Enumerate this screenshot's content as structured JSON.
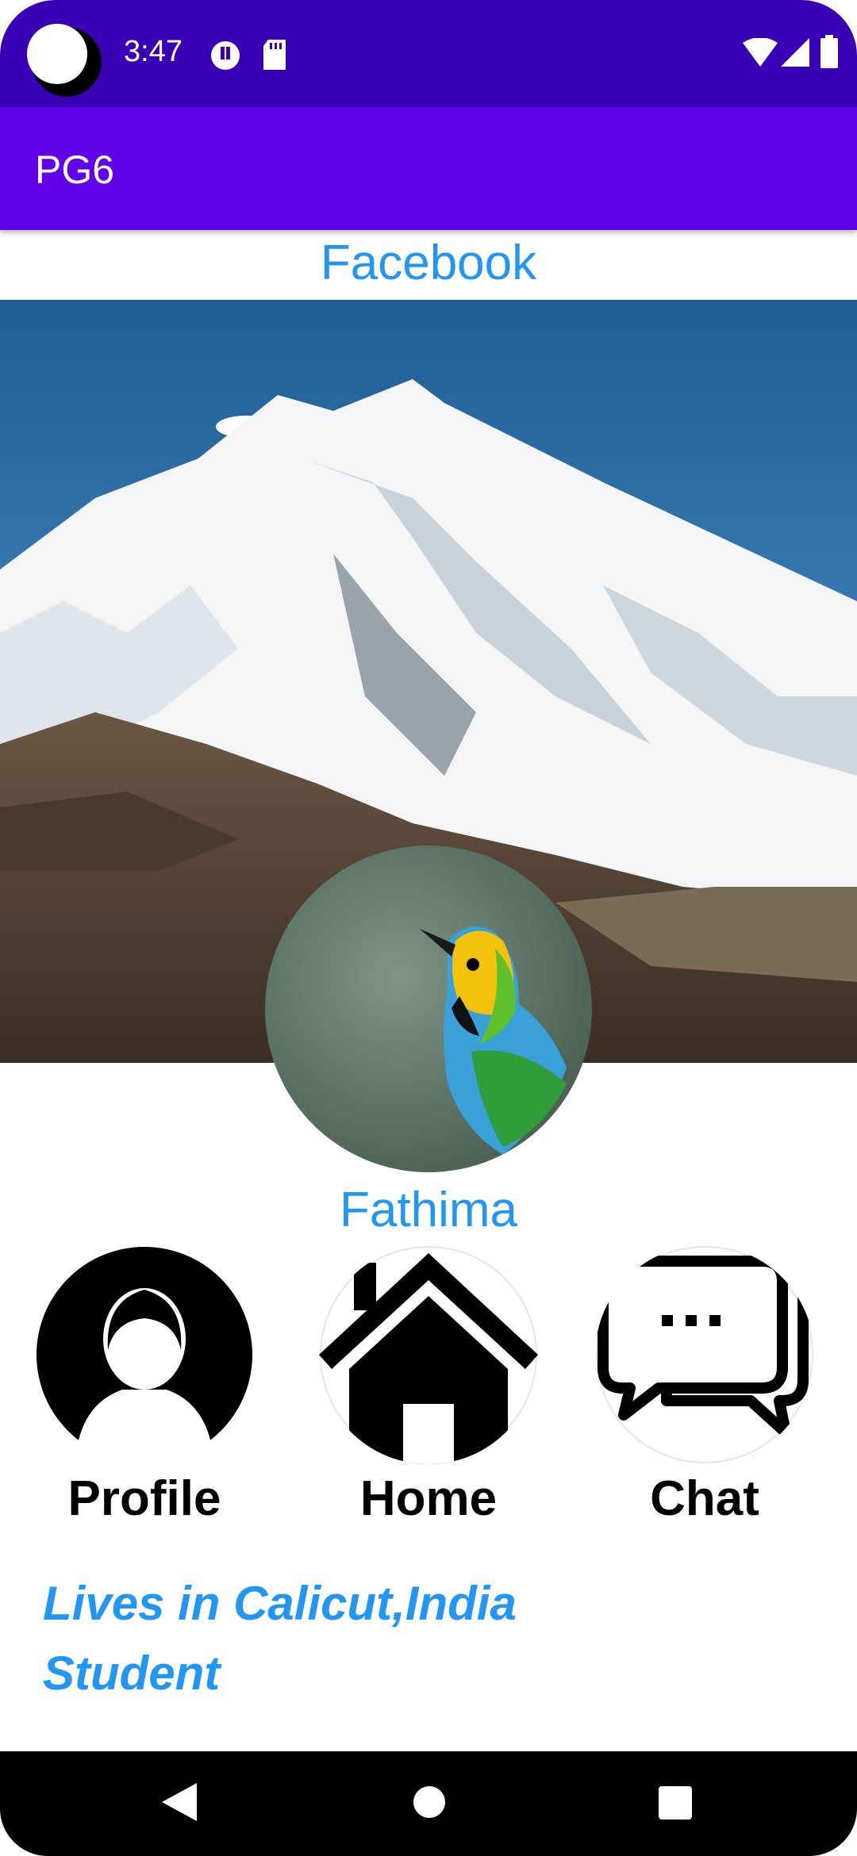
{
  "status_bar": {
    "time": "3:47"
  },
  "app_bar": {
    "title": "PG6"
  },
  "header": {
    "title": "Facebook"
  },
  "profile": {
    "name": "Fathima"
  },
  "nav_buttons": [
    {
      "label": "Profile",
      "icon": "profile-icon"
    },
    {
      "label": "Home",
      "icon": "home-icon"
    },
    {
      "label": "Chat",
      "icon": "chat-icon"
    }
  ],
  "info": {
    "location": "Lives in Calicut,India",
    "occupation": "Student"
  },
  "colors": {
    "status_bar": "#3a00b6",
    "app_bar": "#6200ea",
    "accent_text": "#2196f3"
  }
}
